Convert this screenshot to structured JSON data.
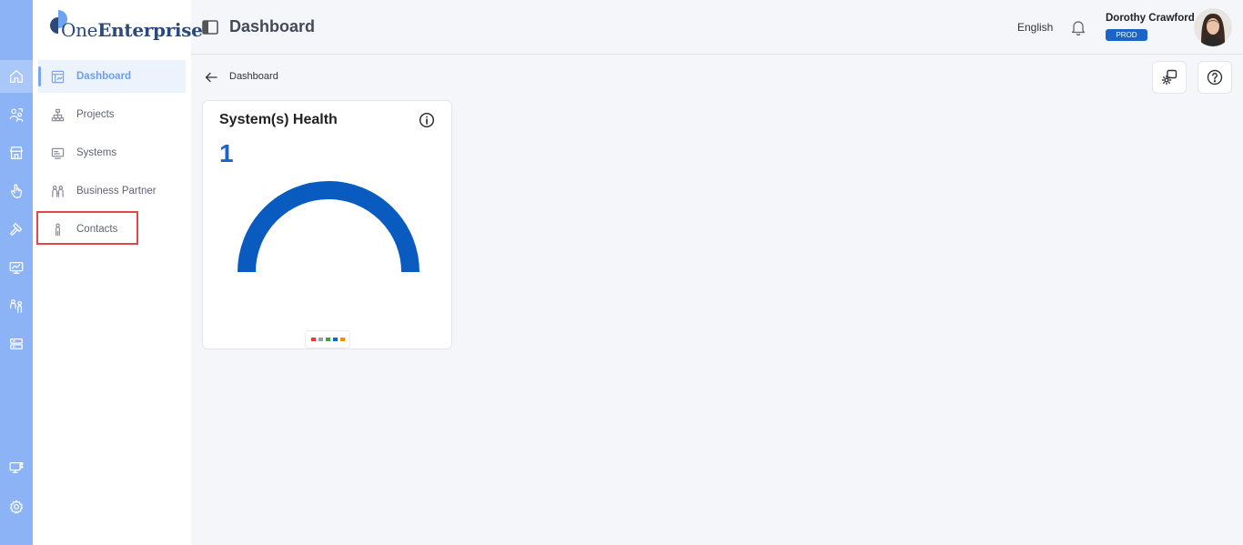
{
  "app": {
    "logo_text_light": "One",
    "logo_text_bold": "Enterprise",
    "brand_color": "#1c64c8"
  },
  "rail": {
    "items": [
      {
        "icon": "home-icon",
        "active": true
      },
      {
        "icon": "users-switch-icon",
        "active": false
      },
      {
        "icon": "store-icon",
        "active": false
      },
      {
        "icon": "hand-pointer-icon",
        "active": false
      },
      {
        "icon": "hammer-icon",
        "active": false
      },
      {
        "icon": "monitor-chart-icon",
        "active": false
      },
      {
        "icon": "people-icon",
        "active": false
      },
      {
        "icon": "server-icon",
        "active": false
      },
      {
        "icon": "desktop-grid-icon",
        "active": false
      },
      {
        "icon": "settings-icon",
        "active": false
      }
    ]
  },
  "sidebar": {
    "items": [
      {
        "label": "Dashboard",
        "icon": "dashboard-icon",
        "active": true
      },
      {
        "label": "Projects",
        "icon": "hierarchy-icon",
        "active": false
      },
      {
        "label": "Systems",
        "icon": "systems-icon",
        "active": false
      },
      {
        "label": "Business Partner",
        "icon": "partners-icon",
        "active": false
      },
      {
        "label": "Contacts",
        "icon": "person-icon",
        "active": false
      }
    ]
  },
  "header": {
    "title": "Dashboard",
    "language": "English",
    "user_name": "Dorothy Crawford",
    "environment": "PROD"
  },
  "breadcrumb": {
    "current": "Dashboard"
  },
  "card": {
    "title": "System(s) Health",
    "count": "1",
    "gauge_color": "#0a5bbf",
    "legend_colors": [
      "#e53935",
      "#9e9e9e",
      "#43a047",
      "#1565c0",
      "#fb8c00"
    ]
  }
}
